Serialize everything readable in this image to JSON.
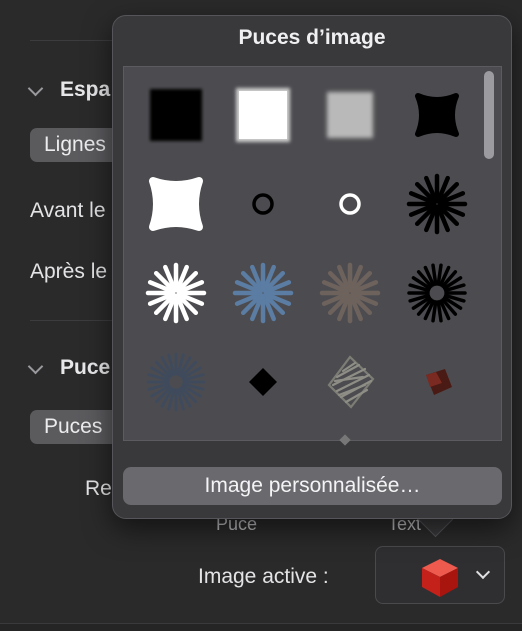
{
  "inspector": {
    "section1": {
      "title": "Espa",
      "pill": "Lignes"
    },
    "before_label": "Avant le",
    "after_label": "Après le",
    "section2": {
      "title": "Puce",
      "pill": "Puces"
    },
    "partial_label": "Re",
    "col_bullet": "Puce",
    "col_text": "Text",
    "active_image_label": "Image active :"
  },
  "popover": {
    "title": "Puces d’image",
    "custom_button": "Image personnalisée…",
    "bullets": [
      {
        "name": "black-square"
      },
      {
        "name": "white-square"
      },
      {
        "name": "gray-square"
      },
      {
        "name": "black-blob"
      },
      {
        "name": "white-blob"
      },
      {
        "name": "small-black-ring"
      },
      {
        "name": "small-white-ring"
      },
      {
        "name": "black-starburst"
      },
      {
        "name": "white-starburst"
      },
      {
        "name": "blue-starburst"
      },
      {
        "name": "brown-starburst"
      },
      {
        "name": "black-radial-burst"
      },
      {
        "name": "dark-blue-radial-burst"
      },
      {
        "name": "black-diamond"
      },
      {
        "name": "scribble-diamond"
      },
      {
        "name": "red-chip"
      }
    ]
  },
  "active_image": {
    "icon": "red-cube"
  },
  "colors": {
    "blue_burst": "#5b7da3",
    "brown_burst": "#6e625c",
    "red_cube": "#e0342c"
  }
}
